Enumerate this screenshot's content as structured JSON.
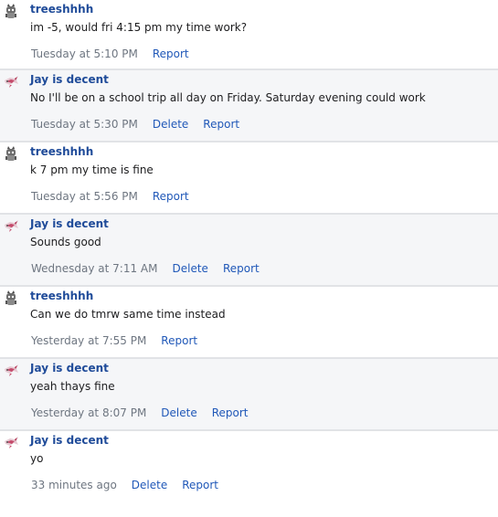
{
  "messages": [
    {
      "author": "treeshhhh",
      "avatar": "treeshhhh-avatar-icon",
      "text": "im -5, would fri 4:15 pm my time work?",
      "time": "Tuesday at 5:10 PM",
      "actions": [
        "Report"
      ]
    },
    {
      "author": "Jay is decent",
      "avatar": "jay-avatar-icon",
      "text": "No I'll be on a school trip all day on Friday. Saturday evening could work",
      "time": "Tuesday at 5:30 PM",
      "actions": [
        "Delete",
        "Report"
      ]
    },
    {
      "author": "treeshhhh",
      "avatar": "treeshhhh-avatar-icon",
      "text": "k 7 pm my time is fine",
      "time": "Tuesday at 5:56 PM",
      "actions": [
        "Report"
      ]
    },
    {
      "author": "Jay is decent",
      "avatar": "jay-avatar-icon",
      "text": "Sounds good",
      "time": "Wednesday at 7:11 AM",
      "actions": [
        "Delete",
        "Report"
      ]
    },
    {
      "author": "treeshhhh",
      "avatar": "treeshhhh-avatar-icon",
      "text": "Can we do tmrw same time instead",
      "time": "Yesterday at 7:55 PM",
      "actions": [
        "Report"
      ]
    },
    {
      "author": "Jay is decent",
      "avatar": "jay-avatar-icon",
      "text": "yeah thays fine",
      "time": "Yesterday at 8:07 PM",
      "actions": [
        "Delete",
        "Report"
      ]
    },
    {
      "author": "Jay is decent",
      "avatar": "jay-avatar-icon",
      "text": "yo",
      "time": "33 minutes ago",
      "actions": [
        "Delete",
        "Report"
      ]
    }
  ]
}
